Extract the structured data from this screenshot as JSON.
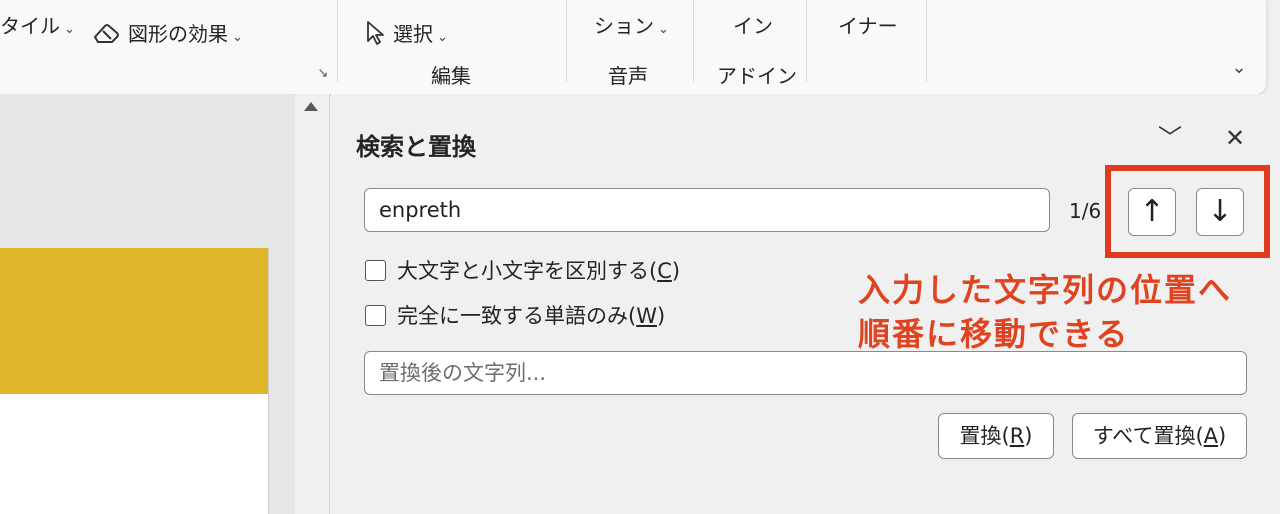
{
  "ribbon": {
    "style_fragment": "タイル",
    "shape_effects": "図形の効果",
    "select": "選択",
    "group_edit": "編集",
    "dictation_fragment": "ション",
    "group_voice": "音声",
    "addin_fragment": "イン",
    "group_addin": "アドイン",
    "designer_fragment": "イナー",
    "chevron": "⌄",
    "collapse": "⌄",
    "launcher": "↘"
  },
  "find_replace": {
    "title": "検索と置換",
    "search_value": "enpreth",
    "counter": "1/6",
    "prev_glyph": "↑",
    "next_glyph": "↓",
    "match_case": {
      "text": "大文字と小文字を区別する(",
      "key": "C",
      "close": ")"
    },
    "whole_word": {
      "text": "完全に一致する単語のみ(",
      "key": "W",
      "close": ")"
    },
    "replace_placeholder": "置換後の文字列...",
    "replace_btn": {
      "text": "置換(",
      "key": "R",
      "close": ")"
    },
    "replace_all_btn": {
      "text": "すべて置換(",
      "key": "A",
      "close": ")"
    },
    "collapse_glyph": "﹀",
    "close_glyph": "✕"
  },
  "annotation": {
    "line1": "入力した文字列の位置へ",
    "line2": "順番に移動できる"
  },
  "colors": {
    "highlight": "#e03b1e",
    "annotation": "#e0431f",
    "slide_band": "#dfb52a"
  }
}
